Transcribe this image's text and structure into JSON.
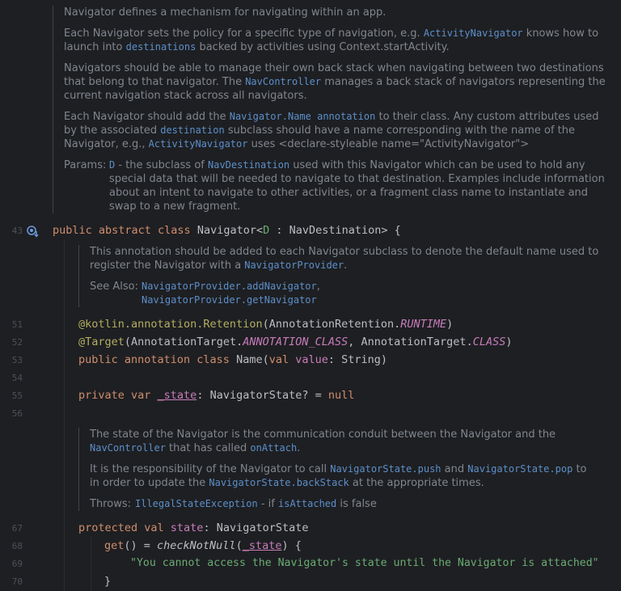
{
  "doc_top": {
    "p1": "Navigator defines a mechanism for navigating within an app.",
    "p2a": "Each Navigator sets the policy for a specific type of navigation, e.g. ",
    "p2_link1": "ActivityNavigator",
    "p2b": " knows how to launch into ",
    "p2_link2": "destinations",
    "p2c": " backed by activities using Context.startActivity.",
    "p3a": "Navigators should be able to manage their own back stack when navigating between two destinations that belong to that navigator. The ",
    "p3_link": "NavController",
    "p3b": " manages a back stack of navigators representing the current navigation stack across all navigators.",
    "p4a": "Each Navigator should add the ",
    "p4_link1": "Navigator.Name annotation",
    "p4b": " to their class. Any custom attributes used by the associated ",
    "p4_link2": "destination",
    "p4c": " subclass should have a name corresponding with the name of the Navigator, e.g., ",
    "p4_link3": "ActivityNavigator",
    "p4d": " uses <declare-styleable name=\"ActivityNavigator\">",
    "params_label": "Params:",
    "param_name": "D",
    "param_a": " - the subclass of ",
    "param_link": "NavDestination",
    "param_b": " used with this Navigator which can be used to hold any special data that will be needed to navigate to that destination. Examples include information about an intent to navigate to other activities, or a fragment class name to instantiate and swap to a new fragment."
  },
  "doc_name": {
    "p1a": "This annotation should be added to each Navigator subclass to denote the default name used to register the Navigator with a ",
    "p1_link": "NavigatorProvider",
    "p1b": ".",
    "see_label": "See Also:",
    "see1": "NavigatorProvider.addNavigator",
    "see2": "NavigatorProvider.getNavigator",
    "comma": ","
  },
  "doc_state": {
    "p1a": "The state of the Navigator is the communication conduit between the Navigator and the ",
    "p1_link1": "NavController",
    "p1b": " that has called ",
    "p1_link2": "onAttach",
    "p1c": ".",
    "p2a": "It is the responsibility of the Navigator to call ",
    "p2_link1": "NavigatorState.push",
    "p2b": " and ",
    "p2_link2": "NavigatorState.pop",
    "p2c": " to in order to update the ",
    "p2_link3": "NavigatorState.backStack",
    "p2d": " at the appropriate times.",
    "throws_label": "Throws:",
    "throws_link": "IllegalStateException",
    "throws_a": " - if ",
    "throws_link2": "isAttached",
    "throws_b": " is false"
  },
  "line_numbers": [
    "43",
    "51",
    "52",
    "53",
    "54",
    "55",
    "56",
    "67",
    "68",
    "69",
    "70"
  ],
  "code": {
    "l43_kw": "public abstract class ",
    "l43_name": "Navigator<",
    "l43_param": "D",
    "l43_rest": " : NavDestination> {",
    "l51_ann": "@kotlin.annotation.Retention",
    "l51_open": "(AnnotationRetention.",
    "l51_const": "RUNTIME",
    "l51_close": ")",
    "l52_ann": "@Target",
    "l52_open": "(AnnotationTarget.",
    "l52_const1": "ANNOTATION_CLASS",
    "l52_mid": ", AnnotationTarget.",
    "l52_const2": "CLASS",
    "l52_close": ")",
    "l53_kw": "public annotation class ",
    "l53_name": "Name",
    "l53_open": "(",
    "l53_val": "val ",
    "l53_prop": "value",
    "l53_rest": ": String)",
    "l55_kw": "private var ",
    "l55_name": "_state",
    "l55_rest": ": NavigatorState? = ",
    "l55_null": "null",
    "l67_kw": "protected val ",
    "l67_name": "state",
    "l67_rest": ": NavigatorState",
    "l68_get": "get",
    "l68_eq": "() = ",
    "l68_fn": "checkNotNull",
    "l68_open": "(",
    "l68_arg": "_state",
    "l68_close": ") {",
    "l69_str": "\"You cannot access the Navigator's state until the Navigator is attached\"",
    "l70": "}"
  }
}
